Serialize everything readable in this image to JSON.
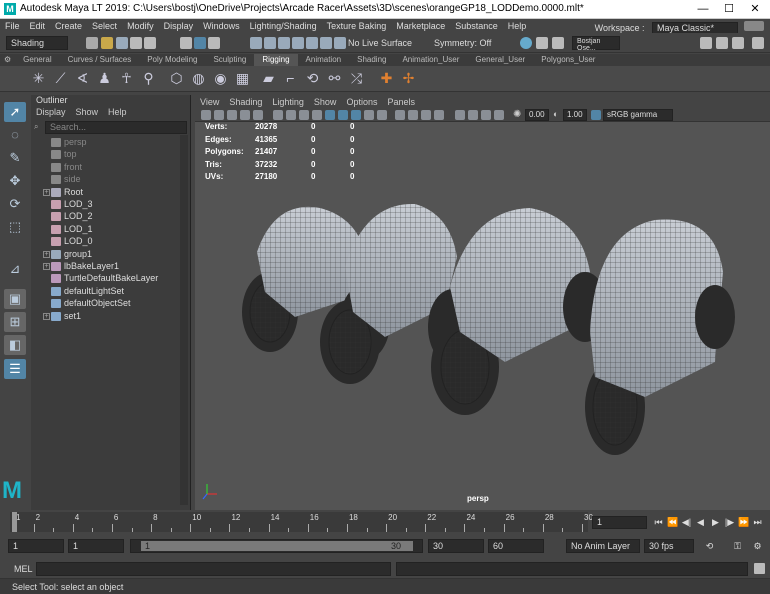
{
  "window": {
    "title": "Autodesk Maya LT 2019: C:\\Users\\bostj\\OneDrive\\Projects\\Arcade Racer\\Assets\\3D\\scenes\\orangeGP18_LODDemo.0000.mlt*",
    "minimize": "—",
    "maximize": "☐",
    "close": "✕"
  },
  "menubar": {
    "items": [
      "File",
      "Edit",
      "Create",
      "Select",
      "Modify",
      "Display",
      "Windows",
      "Lighting/Shading",
      "Texture Baking",
      "Marketplace",
      "Substance",
      "Help"
    ],
    "workspace_label": "Workspace :",
    "workspace_value": "Maya Classic*"
  },
  "statusline": {
    "menuset": "Shading",
    "live_surface": "No Live Surface",
    "symmetry": "Symmetry: Off",
    "user": "Bostjan Ose..."
  },
  "shelf": {
    "tabs": [
      "General",
      "Curves / Surfaces",
      "Poly Modeling",
      "Sculpting",
      "Rigging",
      "Animation",
      "Shading",
      "Animation_User",
      "General_User",
      "Polygons_User"
    ],
    "active_tab": "Rigging"
  },
  "outliner": {
    "title": "Outliner",
    "menu": [
      "Display",
      "Show",
      "Help"
    ],
    "search_placeholder": "Search...",
    "items": [
      {
        "label": "persp",
        "dim": true,
        "icon": "camera-icon",
        "expand": false
      },
      {
        "label": "top",
        "dim": true,
        "icon": "camera-icon",
        "expand": false
      },
      {
        "label": "front",
        "dim": true,
        "icon": "camera-icon",
        "expand": false
      },
      {
        "label": "side",
        "dim": true,
        "icon": "camera-icon",
        "expand": false
      },
      {
        "label": "Root",
        "dim": false,
        "icon": "joint-icon",
        "expand": true
      },
      {
        "label": "LOD_3",
        "dim": false,
        "icon": "mesh-icon",
        "expand": false
      },
      {
        "label": "LOD_2",
        "dim": false,
        "icon": "mesh-icon",
        "expand": false
      },
      {
        "label": "LOD_1",
        "dim": false,
        "icon": "mesh-icon",
        "expand": false
      },
      {
        "label": "LOD_0",
        "dim": false,
        "icon": "mesh-icon",
        "expand": false
      },
      {
        "label": "group1",
        "dim": false,
        "icon": "group-icon",
        "expand": true
      },
      {
        "label": "lbBakeLayer1",
        "dim": false,
        "icon": "layer-icon",
        "expand": true
      },
      {
        "label": "TurtleDefaultBakeLayer",
        "dim": false,
        "icon": "layer-icon",
        "expand": false
      },
      {
        "label": "defaultLightSet",
        "dim": false,
        "icon": "set-icon",
        "expand": false
      },
      {
        "label": "defaultObjectSet",
        "dim": false,
        "icon": "set-icon",
        "expand": false
      },
      {
        "label": "set1",
        "dim": false,
        "icon": "set-icon",
        "expand": true
      }
    ]
  },
  "viewport": {
    "menu": [
      "View",
      "Shading",
      "Lighting",
      "Show",
      "Options",
      "Panels"
    ],
    "exposure": "0.00",
    "gamma": "1.00",
    "colorspace": "sRGB gamma",
    "camera_label": "persp",
    "hud": [
      {
        "label": "Verts:",
        "v1": "20278",
        "v2": "0",
        "v3": "0"
      },
      {
        "label": "Edges:",
        "v1": "41365",
        "v2": "0",
        "v3": "0"
      },
      {
        "label": "Polygons:",
        "v1": "21407",
        "v2": "0",
        "v3": "0"
      },
      {
        "label": "Tris:",
        "v1": "37232",
        "v2": "0",
        "v3": "0"
      },
      {
        "label": "UVs:",
        "v1": "27180",
        "v2": "0",
        "v3": "0"
      }
    ]
  },
  "timeslider": {
    "ticks": [
      "1",
      "2",
      "4",
      "6",
      "8",
      "10",
      "12",
      "14",
      "16",
      "18",
      "20",
      "22",
      "24",
      "26",
      "28",
      "30"
    ],
    "current_frame": "1"
  },
  "range": {
    "start": "1",
    "playback_start": "1",
    "slider_start": "1",
    "slider_end": "30",
    "playback_end": "30",
    "end": "60",
    "anim_layer": "No Anim Layer",
    "fps": "30 fps"
  },
  "mel": {
    "label": "MEL"
  },
  "help_line": "Select Tool: select an object",
  "colors": {
    "accent": "#5285a6",
    "active_tool": "#5285a6"
  }
}
